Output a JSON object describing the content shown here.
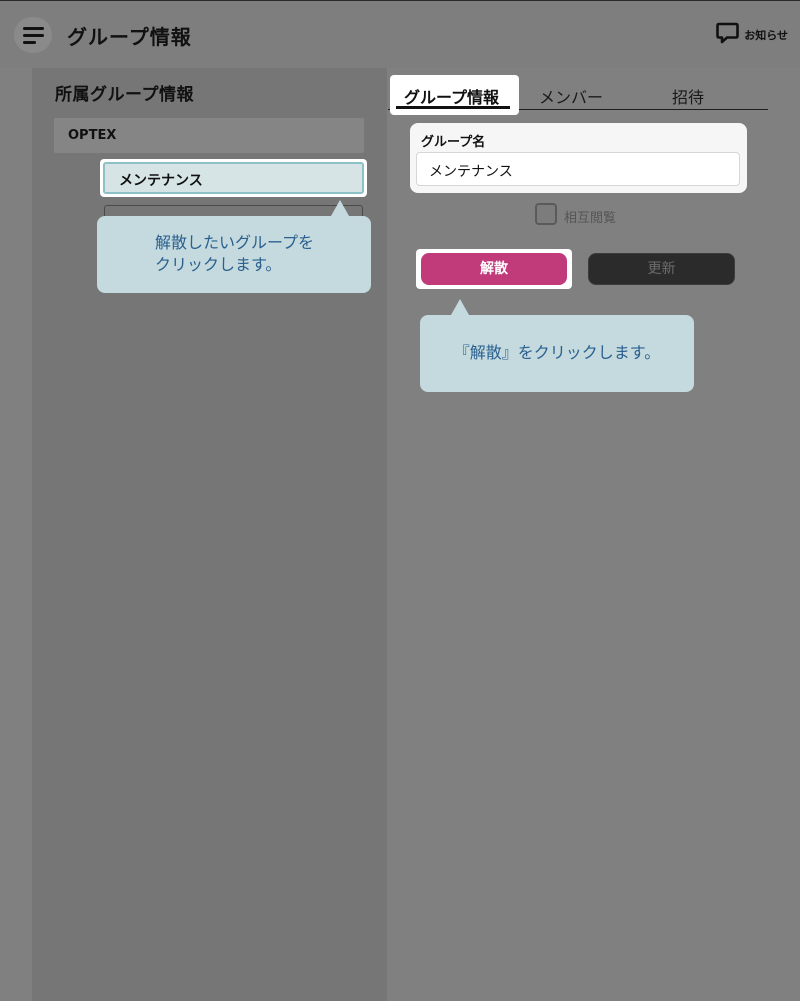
{
  "header": {
    "title": "グループ情報",
    "notice_label": "お知らせ",
    "menu_icon": "menu-icon",
    "notice_icon": "chat-bubble-icon"
  },
  "left_panel": {
    "title": "所属グループ情報",
    "org_name": "OPTEX",
    "groups": [
      {
        "label": "メンテナンス",
        "selected": true
      }
    ]
  },
  "tabs": [
    {
      "label": "グループ情報",
      "active": true
    },
    {
      "label": "メンバー",
      "active": false
    },
    {
      "label": "招待",
      "active": false
    }
  ],
  "form": {
    "group_name_label": "グループ名",
    "group_name_value": "メンテナンス",
    "mutual_view_label": "相互閲覧",
    "mutual_view_checked": false
  },
  "buttons": {
    "dissolve": "解散",
    "update": "更新"
  },
  "callouts": {
    "select_group_line1": "解散したいグループを",
    "select_group_line2": "クリックします。",
    "click_dissolve": "『解散』をクリックします。"
  },
  "colors": {
    "overlay_bg": "#808080",
    "dissolve_button": "#c13a7a",
    "callout_bg": "#c4dade",
    "callout_text": "#2a5f8e",
    "selected_item_bg": "#d6e4e6"
  }
}
